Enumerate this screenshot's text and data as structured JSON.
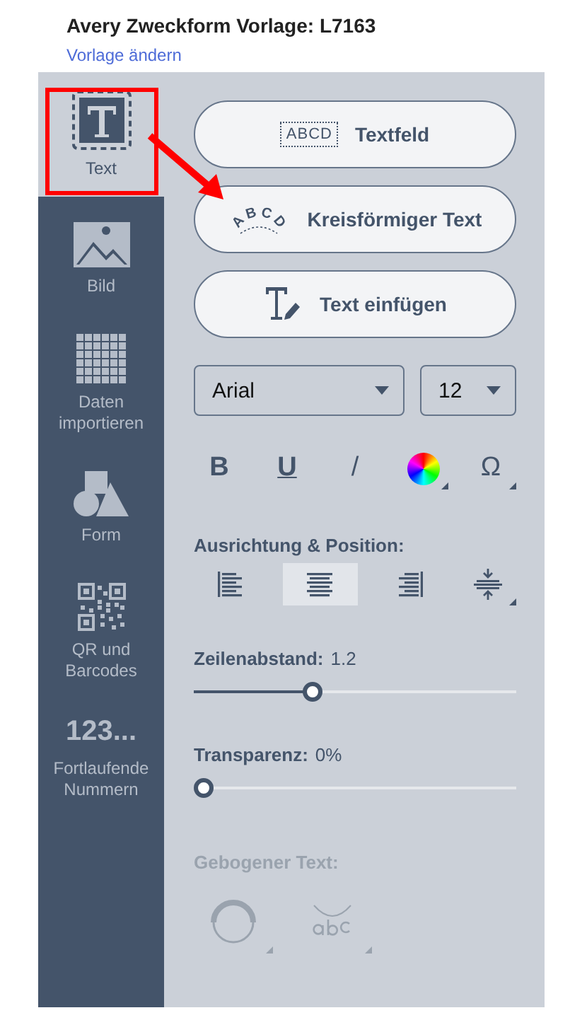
{
  "header": {
    "title": "Avery Zweckform Vorlage: L7163",
    "link": "Vorlage ändern"
  },
  "sidebar": {
    "items": [
      {
        "kind": "text",
        "label": "Text",
        "selected": true
      },
      {
        "kind": "image",
        "label": "Bild",
        "selected": false
      },
      {
        "kind": "grid",
        "label": "Daten importieren",
        "selected": false
      },
      {
        "kind": "shapes",
        "label": "Form",
        "selected": false
      },
      {
        "kind": "qr",
        "label": "QR und Barcodes",
        "selected": false
      },
      {
        "kind": "number",
        "glyph": "123...",
        "label": "Fortlaufende Nummern",
        "selected": false
      }
    ]
  },
  "actions": [
    {
      "kind": "textbox",
      "icon_text": "ABCD",
      "label": "Textfeld"
    },
    {
      "kind": "circular",
      "icon_text": "ABCD",
      "label": "Kreisförmiger Text"
    },
    {
      "kind": "insert",
      "label": "Text einfügen"
    }
  ],
  "font": {
    "family": "Arial",
    "size": "12"
  },
  "format_buttons": [
    {
      "kind": "bold",
      "glyph": "B"
    },
    {
      "kind": "underline",
      "glyph": "U"
    },
    {
      "kind": "italic",
      "glyph": "/"
    },
    {
      "kind": "color"
    },
    {
      "kind": "symbol",
      "glyph": "Ω"
    }
  ],
  "alignment": {
    "label": "Ausrichtung & Position:",
    "options": [
      {
        "kind": "left",
        "selected": false
      },
      {
        "kind": "center",
        "selected": true
      },
      {
        "kind": "right",
        "selected": false
      },
      {
        "kind": "vertical",
        "selected": false
      }
    ]
  },
  "line_spacing": {
    "label": "Zeilenabstand:",
    "reading": "1.2",
    "level": 0.36
  },
  "transparency": {
    "label": "Transparenz:",
    "reading": "0%",
    "level": 0
  },
  "curved_text": {
    "label": "Gebogener Text:",
    "disabled": true
  },
  "annotation": {
    "visible": true
  }
}
